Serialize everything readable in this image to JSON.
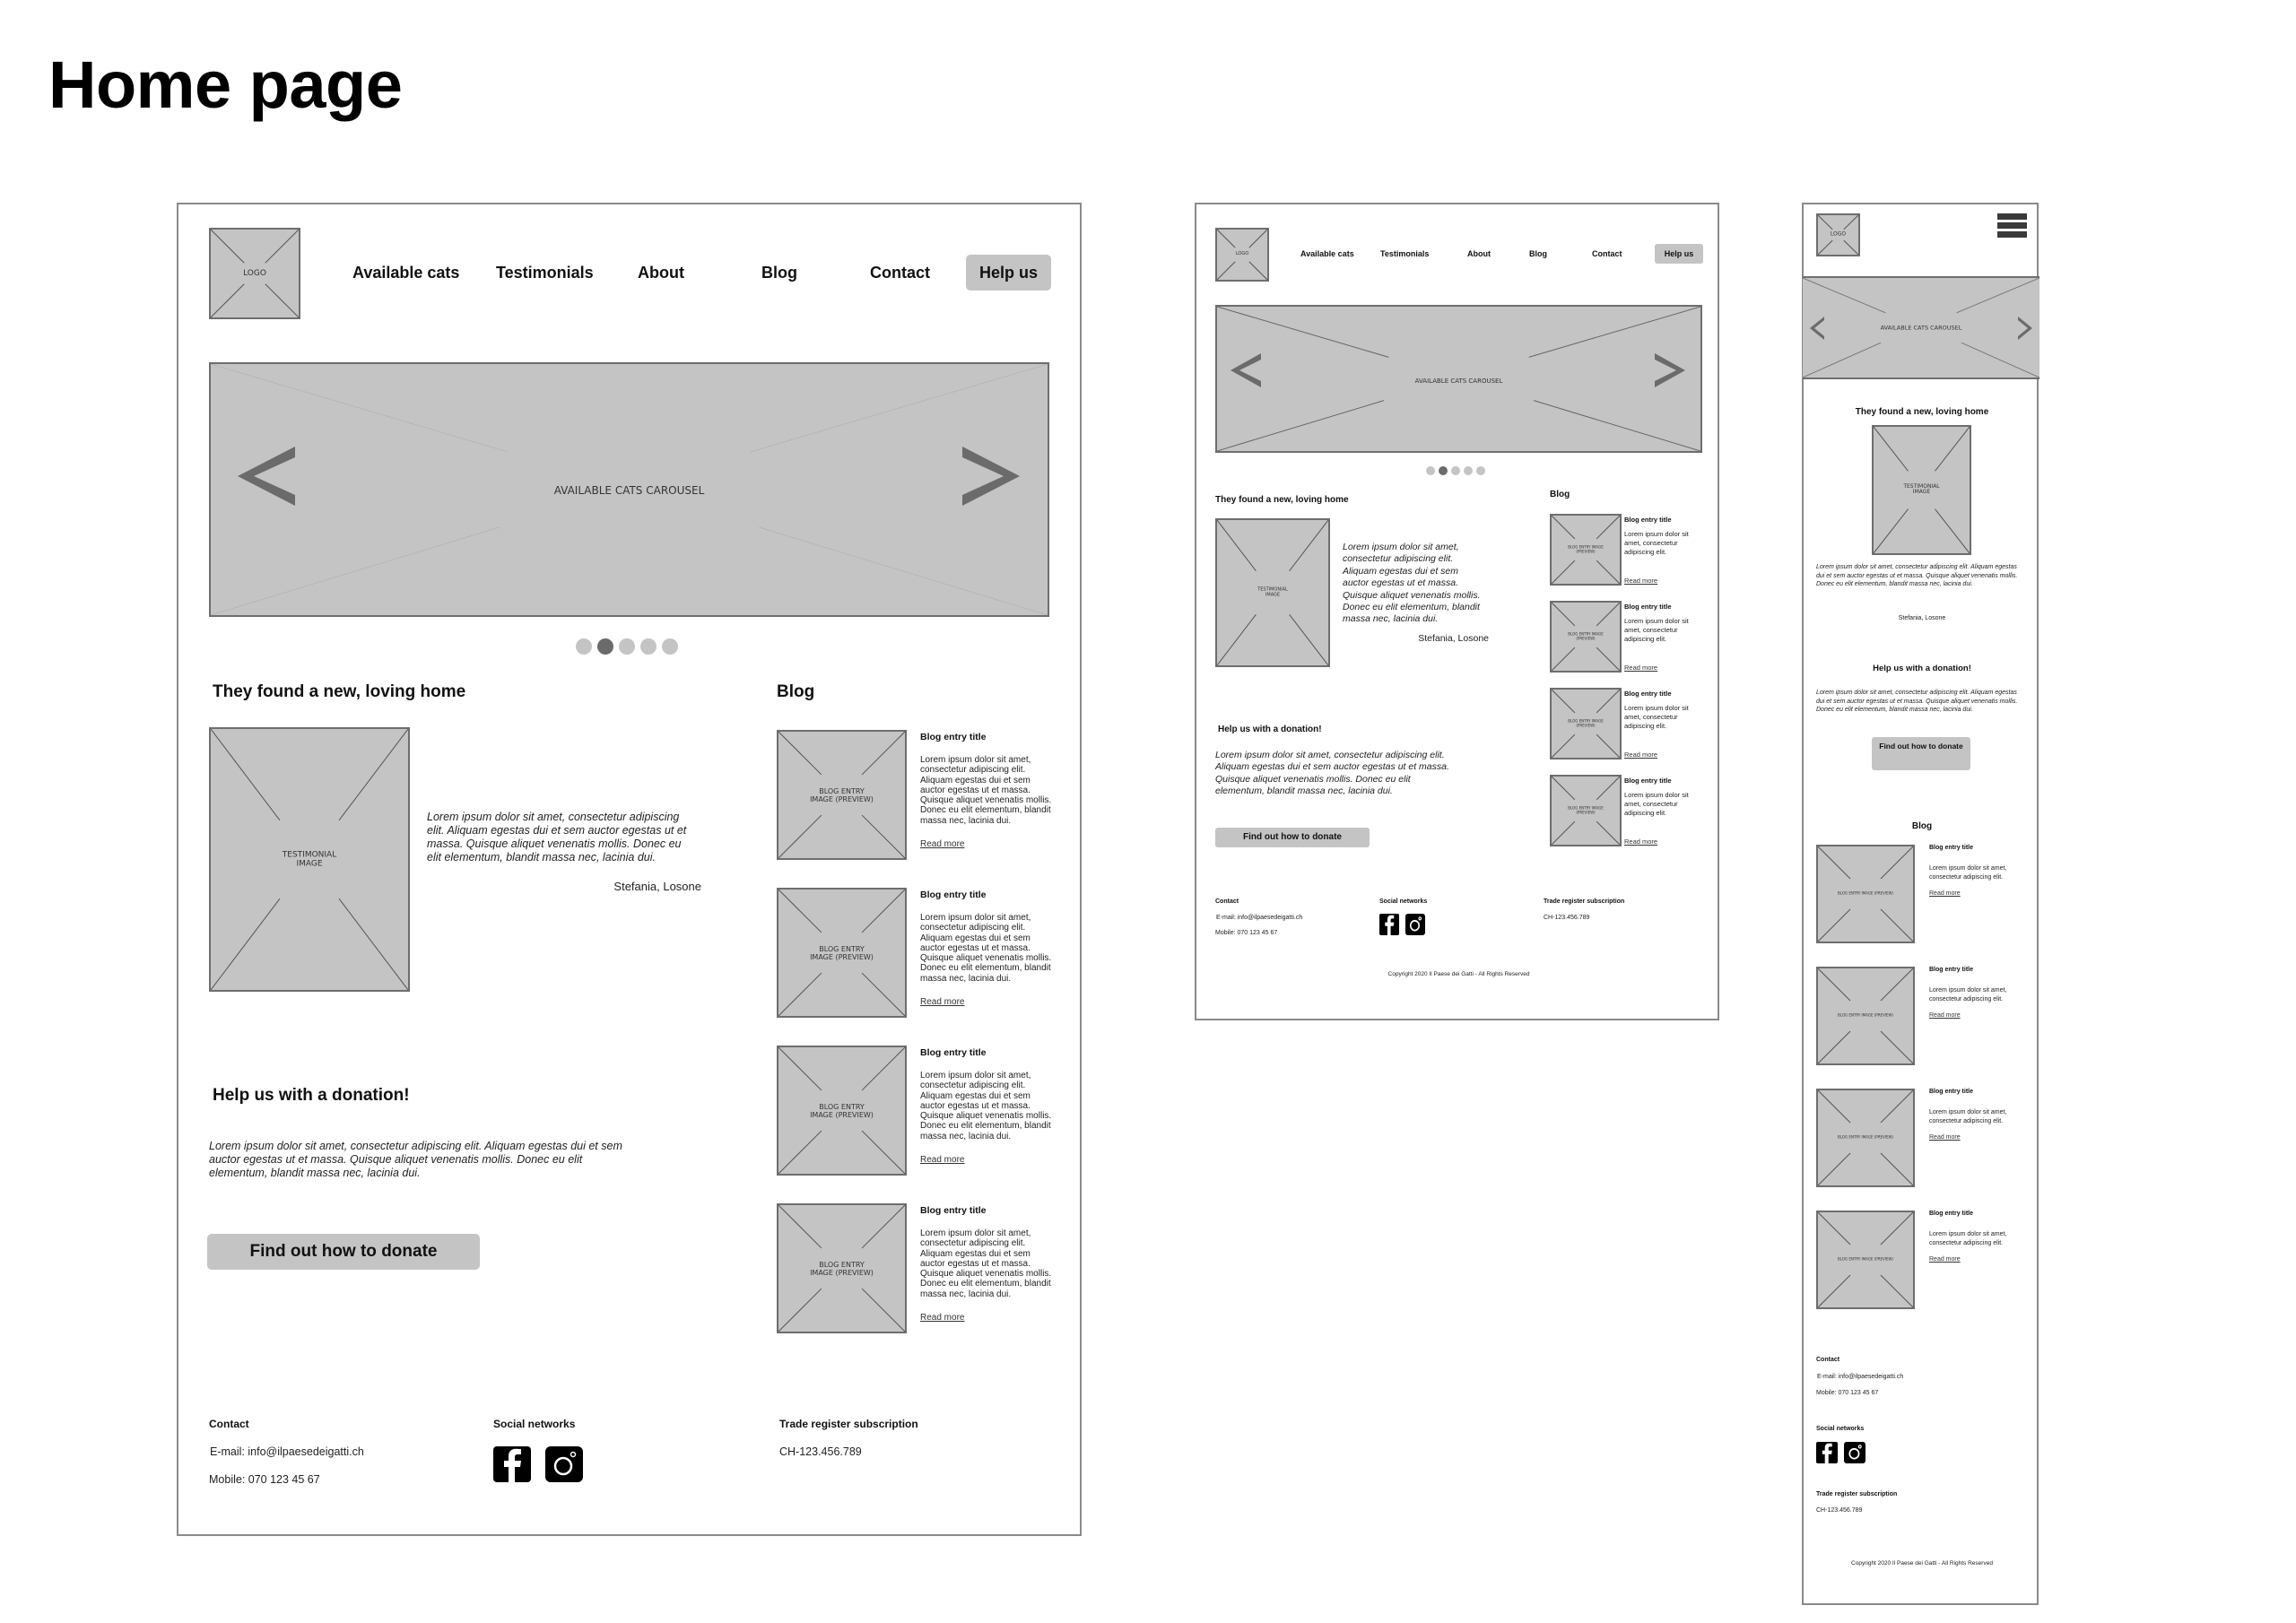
{
  "page_title": "Home page",
  "colors": {
    "placeholder_fill": "#c4c4c4",
    "placeholder_stroke": "#6e6e6e",
    "arrow": "#6b6b6b",
    "dot_active": "#6b6b6b",
    "dot_inactive": "#c4c4c4",
    "frame_border": "#8a8a8a"
  },
  "nav": {
    "logo": "LOGO",
    "items": [
      "Available cats",
      "Testimonials",
      "About",
      "Blog",
      "Contact"
    ],
    "cta": "Help us",
    "menu_icon": "hamburger-menu-icon"
  },
  "carousel": {
    "label": "AVAILABLE CATS CAROUSEL",
    "prev_icon": "chevron-left-icon",
    "next_icon": "chevron-right-icon",
    "dots_total": 5,
    "active_dot": 2
  },
  "testimonial": {
    "heading": "They found a new, loving home",
    "image_label": "TESTIMONIAL IMAGE",
    "quote": "Lorem ipsum dolor sit amet, consectetur adipiscing elit. Aliquam egestas dui et sem auctor egestas ut et massa. Quisque aliquet venenatis mollis. Donec eu elit elementum, blandit massa nec, lacinia dui.",
    "author": "Stefania, Losone"
  },
  "donation": {
    "heading": "Help us with a donation!",
    "text": "Lorem ipsum dolor sit amet, consectetur adipiscing elit. Aliquam egestas dui et sem auctor egestas ut et massa. Quisque aliquet venenatis mollis. Donec eu elit elementum, blandit massa nec, lacinia dui.",
    "button": "Find out how to donate"
  },
  "blog": {
    "heading": "Blog",
    "image_label": "BLOG ENTRY IMAGE (PREVIEW)",
    "entries": [
      {
        "title": "Blog entry title",
        "text_long": "Lorem ipsum dolor sit amet, consectetur adipiscing elit. Aliquam egestas dui et sem auctor egestas ut et massa. Quisque aliquet venenatis mollis. Donec eu elit elementum, blandit massa nec, lacinia dui.",
        "text_short": "Lorem ipsum dolor sit amet, consectetur adipiscing elit.",
        "link": "Read more"
      },
      {
        "title": "Blog entry title",
        "text_long": "Lorem ipsum dolor sit amet, consectetur adipiscing elit. Aliquam egestas dui et sem auctor egestas ut et massa. Quisque aliquet venenatis mollis. Donec eu elit elementum, blandit massa nec, lacinia dui.",
        "text_short": "Lorem ipsum dolor sit amet, consectetur adipiscing elit.",
        "link": "Read more"
      },
      {
        "title": "Blog entry title",
        "text_long": "Lorem ipsum dolor sit amet, consectetur adipiscing elit. Aliquam egestas dui et sem auctor egestas ut et massa. Quisque aliquet venenatis mollis. Donec eu elit elementum, blandit massa nec, lacinia dui.",
        "text_short": "Lorem ipsum dolor sit amet, consectetur adipiscing elit.",
        "link": "Read more"
      },
      {
        "title": "Blog entry title",
        "text_long": "Lorem ipsum dolor sit amet, consectetur adipiscing elit. Aliquam egestas dui et sem auctor egestas ut et massa. Quisque aliquet venenatis mollis. Donec eu elit elementum, blandit massa nec, lacinia dui.",
        "text_short": "Lorem ipsum dolor sit amet, consectetur adipiscing elit.",
        "link": "Read more"
      }
    ]
  },
  "footer": {
    "contact_heading": "Contact",
    "email": "E-mail: info@ilpaesedeigatti.ch",
    "mobile": "Mobile: 070 123 45 67",
    "social_heading": "Social networks",
    "social_icons": [
      "facebook-icon",
      "instagram-icon"
    ],
    "trade_heading": "Trade register subscription",
    "trade_value": "CH-123.456.789",
    "copyright": "Copyright 2020 Il Paese dei Gatti - All Rights Reserved"
  }
}
